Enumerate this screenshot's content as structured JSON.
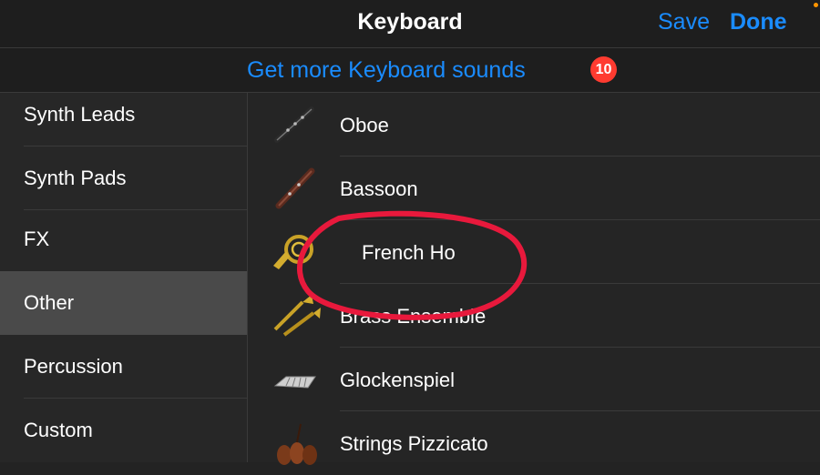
{
  "header": {
    "title": "Keyboard",
    "save_label": "Save",
    "done_label": "Done"
  },
  "store": {
    "link_text": "Get more Keyboard sounds",
    "badge_count": "10"
  },
  "sidebar": {
    "items": [
      {
        "label": "Synth Leads",
        "selected": false
      },
      {
        "label": "Synth Pads",
        "selected": false
      },
      {
        "label": "FX",
        "selected": false
      },
      {
        "label": "Other",
        "selected": true
      },
      {
        "label": "Percussion",
        "selected": false
      },
      {
        "label": "Custom",
        "selected": false
      }
    ]
  },
  "instruments": {
    "items": [
      {
        "label": "Oboe",
        "icon": "oboe-icon"
      },
      {
        "label": "Bassoon",
        "icon": "bassoon-icon"
      },
      {
        "label": "French Ho",
        "icon": "french-horn-icon"
      },
      {
        "label": "Brass Ensemble",
        "icon": "brass-ensemble-icon"
      },
      {
        "label": "Glockenspiel",
        "icon": "glockenspiel-icon"
      },
      {
        "label": "Strings Pizzicato",
        "icon": "strings-icon"
      }
    ]
  },
  "colors": {
    "accent": "#1a8cff",
    "badge": "#ff3b30",
    "annotation": "#e8193c",
    "selected_bg": "#4a4a4a",
    "background": "#232323"
  }
}
